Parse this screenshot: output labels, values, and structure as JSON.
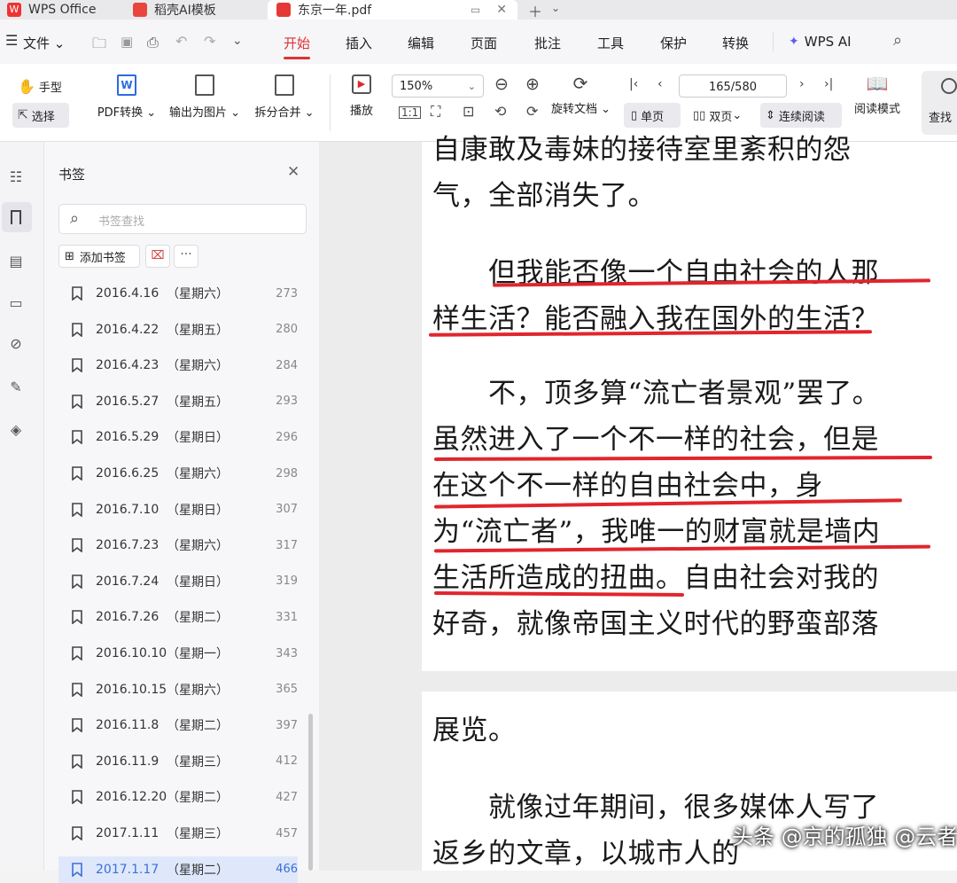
{
  "tabs": [
    {
      "label": "WPS Office"
    },
    {
      "label": "稻壳AI模板"
    },
    {
      "label": "东京一年.pdf"
    }
  ],
  "menu": {
    "file": "文件",
    "items": [
      "开始",
      "插入",
      "编辑",
      "页面",
      "批注",
      "工具",
      "保护",
      "转换"
    ],
    "ai": "WPS AI"
  },
  "ribbon": {
    "hand": "手型",
    "select": "选择",
    "pdf_convert": "PDF转换",
    "export_image": "输出为图片",
    "split_merge": "拆分合并",
    "play": "播放",
    "zoom": "150%",
    "rotate": "旋转文档",
    "page_indicator": "165/580",
    "single": "单页",
    "double": "双页",
    "continuous": "连续阅读",
    "read_mode": "阅读模式",
    "find": "查找"
  },
  "panel": {
    "title": "书签",
    "search_placeholder": "书签查找",
    "add_bookmark": "添加书签"
  },
  "bookmarks": [
    {
      "date": "2016.4.16",
      "weekday": "（星期六）",
      "page": "273"
    },
    {
      "date": "2016.4.22",
      "weekday": "（星期五）",
      "page": "280"
    },
    {
      "date": "2016.4.23",
      "weekday": "（星期六）",
      "page": "284"
    },
    {
      "date": "2016.5.27",
      "weekday": "（星期五）",
      "page": "293"
    },
    {
      "date": "2016.5.29",
      "weekday": "（星期日）",
      "page": "296"
    },
    {
      "date": "2016.6.25",
      "weekday": "（星期六）",
      "page": "298"
    },
    {
      "date": "2016.7.10",
      "weekday": "（星期日）",
      "page": "307"
    },
    {
      "date": "2016.7.23",
      "weekday": "（星期六）",
      "page": "317"
    },
    {
      "date": "2016.7.24",
      "weekday": "（星期日）",
      "page": "319"
    },
    {
      "date": "2016.7.26",
      "weekday": "（星期二）",
      "page": "331"
    },
    {
      "date": "2016.10.10",
      "weekday": "（星期一）",
      "page": "343"
    },
    {
      "date": "2016.10.15",
      "weekday": "（星期六）",
      "page": "365"
    },
    {
      "date": "2016.11.8",
      "weekday": "（星期二）",
      "page": "397"
    },
    {
      "date": "2016.11.9",
      "weekday": "（星期三）",
      "page": "412"
    },
    {
      "date": "2016.12.20",
      "weekday": "（星期二）",
      "page": "427"
    },
    {
      "date": "2017.1.11",
      "weekday": "（星期三）",
      "page": "457"
    },
    {
      "date": "2017.1.17",
      "weekday": "（星期二）",
      "page": "466"
    }
  ],
  "document": {
    "page1": [
      "自康敢及毒妹的接待室里紊积的怨",
      "气，全部消失了。",
      "　　但我能否像一个自由社会的人那",
      "样生活？能否融入我在国外的生活？",
      "　　不，顶多算“流亡者景观”罢了。",
      "虽然进入了一个不一样的社会，但是",
      "在这个不一样的自由社会中，身",
      "为“流亡者”，我唯一的财富就是墙内",
      "生活所造成的扭曲。自由社会对我的",
      "好奇，就像帝国主义时代的野蛮部落"
    ],
    "page2": [
      "展览。",
      "　　就像过年期间，很多媒体人写了",
      "返乡的文章，以城市人的"
    ]
  },
  "watermark": "头条 @京的孤独 @云者青锋",
  "colors": {
    "accent": "#d33",
    "underline": "#e0262c",
    "selected": "#3b6fd8"
  }
}
